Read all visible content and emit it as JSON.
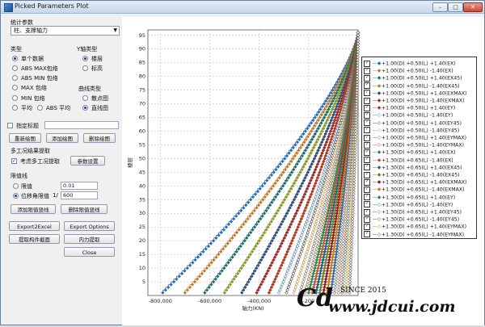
{
  "window": {
    "title": "Picked Parameters Plot"
  },
  "left_panel": {
    "stat_param_label": "统计参数",
    "stat_param_value": "柱、支撑轴力",
    "type_label": "类型",
    "yaxis_type_label": "Y轴类型",
    "type_options": [
      "单个数据",
      "ABS MAX包络",
      "ABS MIN 包络",
      "MAX 包络",
      "MIN 包络",
      "平均",
      "ABS 平均"
    ],
    "yaxis_options": [
      "楼层",
      "标高"
    ],
    "curve_type_label": "曲线类型",
    "curve_options": [
      "散点图",
      "直线图"
    ],
    "specify_title_label": "指定标题",
    "btn_redraw": "重新绘图",
    "btn_add": "添加绘图",
    "btn_delete": "删除绘图",
    "multi_case_label": "多工况结果提取",
    "extract_check_label": "考虑多工况提取",
    "btn_param_settings": "参数设置",
    "limit_label": "限值线",
    "limit_options": [
      "限值",
      "位移角限值"
    ],
    "limit_value": "0.01",
    "drift_prefix": "1/",
    "drift_value": "600",
    "btn_add_limit": "添加限值竖线",
    "btn_del_limit": "删除限值竖线",
    "btn_export_excel": "Export2Excel",
    "btn_export_options": "Export Options",
    "btn_extract_section": "提取构件截面",
    "btn_internal_force": "内力提取",
    "btn_close": "Close"
  },
  "chart_data": {
    "type": "line",
    "ylabel": "楼层",
    "xlabel": "轴力(KN)",
    "x_ticks": [
      "-800,000",
      "-600,000",
      "-400,000",
      "-200"
    ],
    "x_tick_values": [
      -800000,
      -600000,
      -400000,
      -200000
    ],
    "xlim": [
      -850000,
      0
    ],
    "ylim": [
      0,
      97
    ],
    "y_ticks": [
      5,
      10,
      15,
      20,
      25,
      30,
      35,
      40,
      45,
      50,
      55,
      60,
      65,
      70,
      75,
      80,
      85,
      90,
      95
    ],
    "grid": true,
    "legend_placement": "right",
    "series": [
      {
        "name": "+1.00(D) +0.50(L) +1.40(EX)",
        "color": "#2b6db5",
        "marker": "◆",
        "x_at_base": -790000
      },
      {
        "name": "+1.00(D) +0.50(L) -1.40(EX)",
        "color": "#c27a2c",
        "marker": "◆",
        "x_at_base": -700000
      },
      {
        "name": "+1.00(D) +0.50(L) +1.40(EX45)",
        "color": "#1e6e6e",
        "marker": "◆",
        "x_at_base": -620000
      },
      {
        "name": "+1.00(D) +0.50(L) -1.40(EX45)",
        "color": "#8a9a2a",
        "marker": "◆",
        "x_at_base": -540000
      },
      {
        "name": "+1.00(D) +0.50(L) +1.40(EXMAX)",
        "color": "#2f4f7f",
        "marker": "◆",
        "x_at_base": -470000
      },
      {
        "name": "+1.00(D) +0.50(L) -1.40(EXMAX)",
        "color": "#9a2b2b",
        "marker": "◆",
        "x_at_base": -410000
      },
      {
        "name": "+1.00(D) +0.50(L) +1.40(EY)",
        "color": "#b23a1f",
        "marker": "◆",
        "x_at_base": -360000
      },
      {
        "name": "+1.00(D) +0.50(L) -1.40(EY)",
        "color": "#4c7fa8",
        "marker": "◇",
        "x_at_base": -320000
      },
      {
        "name": "+1.00(D) +0.50(L) +1.40(EY45)",
        "color": "#3c3c3c",
        "marker": "◇",
        "x_at_base": -290000
      },
      {
        "name": "+1.00(D) +0.50(L) -1.40(EY45)",
        "color": "#c48a2a",
        "marker": "◇",
        "x_at_base": -260000
      },
      {
        "name": "+1.00(D) +0.50(L) +1.40(EYMAX)",
        "color": "#6b6b6b",
        "marker": "◇",
        "x_at_base": -235000
      },
      {
        "name": "+1.00(D) +0.50(L) -1.40(EYMAX)",
        "color": "#8a5c2e",
        "marker": "◇",
        "x_at_base": -215000
      },
      {
        "name": "+1.30(D) +0.65(L) +1.40(EX)",
        "color": "#2e8b57",
        "marker": "◆",
        "x_at_base": -200000
      },
      {
        "name": "+1.30(D) +0.65(L) -1.40(EX)",
        "color": "#c2552c",
        "marker": "◆",
        "x_at_base": -185000
      },
      {
        "name": "+1.30(D) +0.65(L) +1.40(EX45)",
        "color": "#1f5f8b",
        "marker": "◆",
        "x_at_base": -170000
      },
      {
        "name": "+1.30(D) +0.65(L) -1.40(EX45)",
        "color": "#7a7a2a",
        "marker": "◆",
        "x_at_base": -155000
      },
      {
        "name": "+1.30(D) +0.65(L) +1.40(EXMAX)",
        "color": "#8b1e1e",
        "marker": "◆",
        "x_at_base": -140000
      },
      {
        "name": "+1.30(D) +0.65(L) -1.40(EXMAX)",
        "color": "#d0761e",
        "marker": "◆",
        "x_at_base": -125000
      },
      {
        "name": "+1.30(D) +0.65(L) +1.40(EY)",
        "color": "#3a6f9f",
        "marker": "◆",
        "x_at_base": -110000
      },
      {
        "name": "+1.30(D) +0.65(L) -1.40(EY)",
        "color": "#5a5a5a",
        "marker": "◇",
        "x_at_base": -95000
      },
      {
        "name": "+1.30(D) +0.65(L) +1.40(EY45)",
        "color": "#a0522d",
        "marker": "◇",
        "x_at_base": -80000
      },
      {
        "name": "+1.30(D) +0.65(L) -1.40(EY45)",
        "color": "#2f4f4f",
        "marker": "◇",
        "x_at_base": -65000
      },
      {
        "name": "+1.30(D) +0.65(L) +1.40(EYMAX)",
        "color": "#b8860b",
        "marker": "◇",
        "x_at_base": -50000
      },
      {
        "name": "+1.30(D) +0.65(L) -1.40(EYMAX)",
        "color": "#444444",
        "marker": "◇",
        "x_at_base": -35000
      }
    ]
  },
  "watermark": {
    "since": "SINCE 2015",
    "site": "www.jdcui.com",
    "logo": "Cd"
  }
}
